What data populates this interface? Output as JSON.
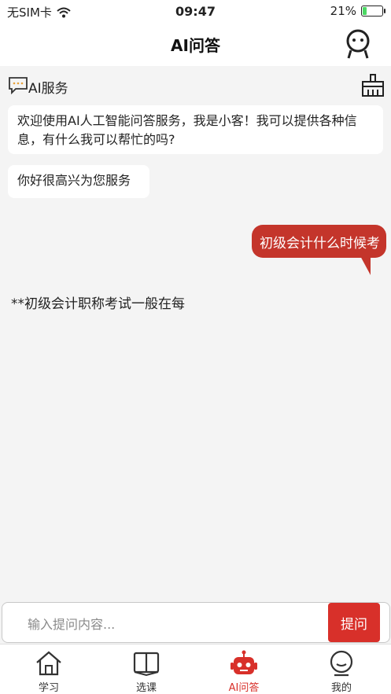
{
  "status": {
    "carrier": "无SIM卡",
    "time": "09:47",
    "battery_percent": "21%",
    "battery_level": 0.21
  },
  "header": {
    "title": "AI问答"
  },
  "service": {
    "label": "AI服务"
  },
  "messages": [
    {
      "from": "bot",
      "text": "欢迎使用AI人工智能问答服务，我是小客！我可以提供各种信息，有什么我可以帮忙的吗?"
    },
    {
      "from": "bot",
      "text": "你好很高兴为您服务"
    },
    {
      "from": "user",
      "text": "初级会计什么时候考"
    },
    {
      "from": "bot",
      "text": "**初级会计职称考试一般在每"
    }
  ],
  "input": {
    "placeholder": "输入提问内容...",
    "submit_label": "提问"
  },
  "tabs": [
    {
      "label": "学习",
      "icon": "home-icon",
      "active": false
    },
    {
      "label": "选课",
      "icon": "book-icon",
      "active": false
    },
    {
      "label": "AI问答",
      "icon": "robot-icon",
      "active": true
    },
    {
      "label": "我的",
      "icon": "profile-icon",
      "active": false
    }
  ],
  "colors": {
    "accent": "#d8302a",
    "user_bubble": "#c4352b",
    "background": "#f4f4f4"
  }
}
